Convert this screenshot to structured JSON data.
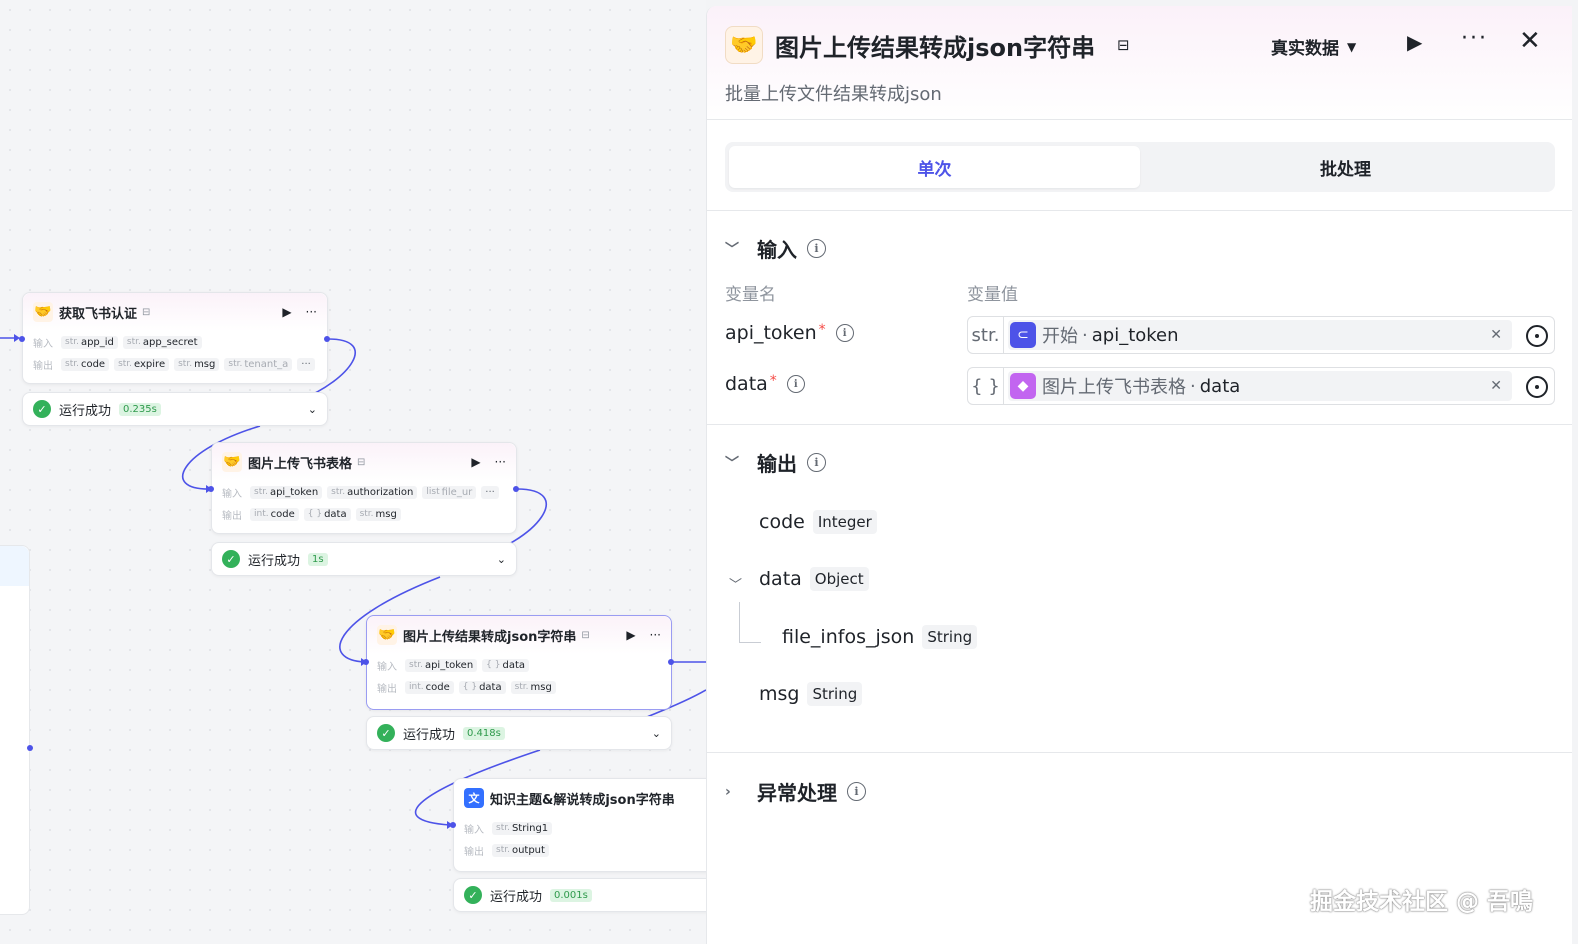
{
  "canvas": {
    "io_in": "输入",
    "io_out": "输出",
    "more": "···",
    "nodes": [
      {
        "title": "获取飞书认证",
        "inputs": [
          {
            "type": "str.",
            "name": "app_id"
          },
          {
            "type": "str.",
            "name": "app_secret"
          }
        ],
        "outputs": [
          {
            "type": "str.",
            "name": "code"
          },
          {
            "type": "str.",
            "name": "expire"
          },
          {
            "type": "str.",
            "name": "msg"
          },
          {
            "type": "str.",
            "name": "tenant_a"
          }
        ],
        "status": "运行成功",
        "time": "0.235s"
      },
      {
        "title": "图片上传飞书表格",
        "inputs": [
          {
            "type": "str.",
            "name": "api_token"
          },
          {
            "type": "str.",
            "name": "authorization"
          },
          {
            "type": "list",
            "name": "file_ur"
          }
        ],
        "outputs": [
          {
            "type": "int.",
            "name": "code"
          },
          {
            "type": "{ }",
            "name": "data"
          },
          {
            "type": "str.",
            "name": "msg"
          }
        ],
        "status": "运行成功",
        "time": "1s"
      },
      {
        "title": "图片上传结果转成json字符串",
        "inputs": [
          {
            "type": "str.",
            "name": "api_token"
          },
          {
            "type": "{ }",
            "name": "data"
          }
        ],
        "outputs": [
          {
            "type": "int.",
            "name": "code"
          },
          {
            "type": "{ }",
            "name": "data"
          },
          {
            "type": "str.",
            "name": "msg"
          }
        ],
        "status": "运行成功",
        "time": "0.418s"
      },
      {
        "title": "知识主题&解说转成json字符串",
        "inputs": [
          {
            "type": "str.",
            "name": "String1"
          }
        ],
        "outputs": [
          {
            "type": "str.",
            "name": "output"
          }
        ],
        "status": "运行成功",
        "time": "0.001s"
      }
    ]
  },
  "panel": {
    "title": "图片上传结果转成json字符串",
    "description": "批量上传文件结果转成json",
    "mode": "真实数据",
    "tabs": [
      "单次",
      "批处理"
    ],
    "input_section": "输入",
    "col_name": "变量名",
    "col_value": "变量值",
    "inputs": [
      {
        "name": "api_token",
        "type": "str.",
        "ref_node": "开始",
        "ref_var": "api_token",
        "color": "#4d53e8"
      },
      {
        "name": "data",
        "type": "{ }",
        "ref_node": "图片上传飞书表格",
        "ref_var": "data",
        "color": "#c265f0"
      }
    ],
    "output_section": "输出",
    "outputs": [
      {
        "name": "code",
        "type": "Integer"
      },
      {
        "name": "data",
        "type": "Object"
      },
      {
        "name": "file_infos_json",
        "type": "String"
      },
      {
        "name": "msg",
        "type": "String"
      }
    ],
    "exception_section": "异常处理"
  },
  "watermark": "掘金技术社区 @ 吾鳴"
}
